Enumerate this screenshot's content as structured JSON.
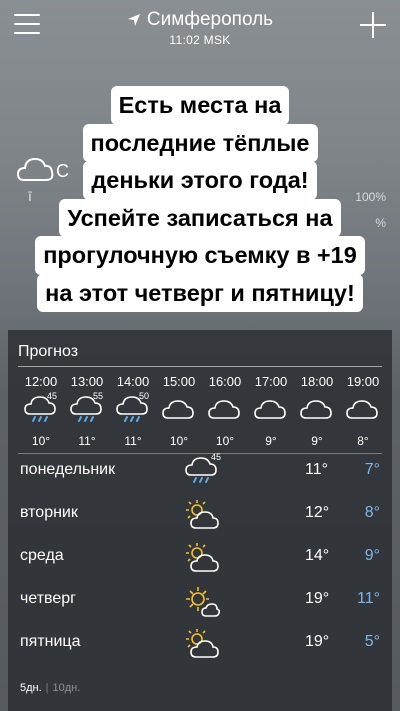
{
  "header": {
    "city": "Симферополь",
    "time": "11:02 MSK"
  },
  "background": {
    "partial_letter": "С",
    "partial_meta": "ī",
    "pct1": "100%",
    "pct2": "%"
  },
  "promo_lines": [
    "Есть места на",
    "последние тёплые",
    "деньки этого года!",
    "Успейте записаться на",
    "прогулочную съемку в +19",
    "на этот четверг и пятницу!"
  ],
  "forecast": {
    "title": "Прогноз",
    "hourly": [
      {
        "time": "12:00",
        "icon": "rain-cloud-icon",
        "prob": "45",
        "temp": "10°"
      },
      {
        "time": "13:00",
        "icon": "rain-cloud-icon",
        "prob": "55",
        "temp": "11°"
      },
      {
        "time": "14:00",
        "icon": "rain-cloud-icon",
        "prob": "50",
        "temp": "11°"
      },
      {
        "time": "15:00",
        "icon": "cloud-icon",
        "prob": "",
        "temp": "10°"
      },
      {
        "time": "16:00",
        "icon": "cloud-icon",
        "prob": "",
        "temp": "10°"
      },
      {
        "time": "17:00",
        "icon": "cloud-icon",
        "prob": "",
        "temp": "9°"
      },
      {
        "time": "18:00",
        "icon": "cloud-icon",
        "prob": "",
        "temp": "9°"
      },
      {
        "time": "19:00",
        "icon": "cloud-icon",
        "prob": "",
        "temp": "8°"
      }
    ],
    "daily": [
      {
        "day": "понедельник",
        "icon": "rain-cloud-icon",
        "prob": "45",
        "max": "11°",
        "min": "7°"
      },
      {
        "day": "вторник",
        "icon": "sun-cloud-icon",
        "prob": "",
        "max": "12°",
        "min": "8°"
      },
      {
        "day": "среда",
        "icon": "sun-cloud-icon",
        "prob": "",
        "max": "14°",
        "min": "9°"
      },
      {
        "day": "четверг",
        "icon": "sun-small-cloud-icon",
        "prob": "",
        "max": "19°",
        "min": "11°"
      },
      {
        "day": "пятница",
        "icon": "sun-cloud-icon",
        "prob": "",
        "max": "19°",
        "min": "5°"
      }
    ],
    "range_active": "5дн.",
    "range_inactive": "10дн."
  }
}
